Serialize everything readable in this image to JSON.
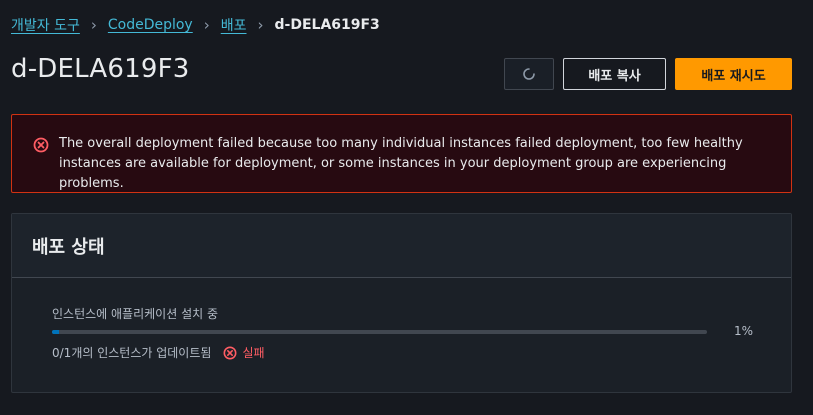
{
  "breadcrumb": {
    "items": [
      "개발자 도구",
      "CodeDeploy",
      "배포"
    ],
    "current": "d-DELA619F3"
  },
  "page": {
    "title": "d-DELA619F3"
  },
  "actions": {
    "refresh_icon": "refresh-spinner-icon",
    "copy_label": "배포 복사",
    "retry_label": "배포 재시도"
  },
  "alert": {
    "icon": "error-circle-icon",
    "message": "The overall deployment failed because too many individual instances failed deployment, too few healthy instances are available for deployment, or some instances in your deployment group are experiencing problems."
  },
  "status_panel": {
    "title": "배포 상태",
    "progress_label": "인스턴스에 애플리케이션 설치 중",
    "progress_fraction": 0.01,
    "progress_text": "1%",
    "updated_text": "0/1개의 인스턴스가 업데이트됨",
    "fail_label": "실패"
  },
  "colors": {
    "background": "#16191f",
    "link": "#44b9d6",
    "primary_button": "#ff9900",
    "error": "#d13212",
    "error_text": "#ff5d64",
    "progress": "#0073bb"
  }
}
